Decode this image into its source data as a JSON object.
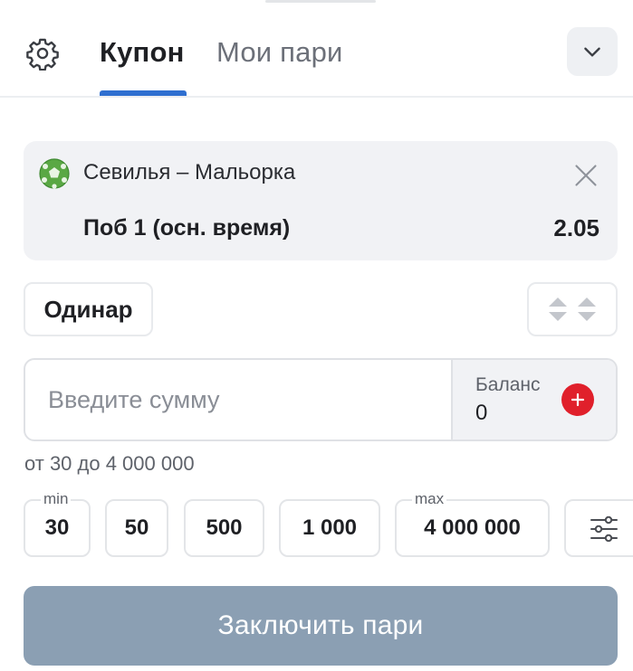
{
  "header": {
    "tabs": [
      {
        "label": "Купон",
        "active": true
      },
      {
        "label": "Мои пари",
        "active": false
      }
    ],
    "icons": {
      "settings": "gear-icon",
      "collapse": "chevron-down-icon"
    }
  },
  "bet": {
    "sport_icon": "soccer-ball-icon",
    "match": "Севилья – Мальорка",
    "outcome": "Поб 1 (осн. время)",
    "odds": "2.05"
  },
  "bet_type": {
    "label": "Одинар"
  },
  "amount": {
    "placeholder": "Введите сумму",
    "value": "",
    "balance_label": "Баланс",
    "balance_value": "0"
  },
  "limits_text": "от 30 до 4 000 000",
  "quick_amounts": [
    {
      "label": "30",
      "tag": "min"
    },
    {
      "label": "50",
      "tag": ""
    },
    {
      "label": "500",
      "tag": ""
    },
    {
      "label": "1 000",
      "tag": ""
    },
    {
      "label": "4 000 000",
      "tag": "max"
    }
  ],
  "submit_label": "Заключить пари",
  "colors": {
    "accent": "#2f6fd0",
    "submit_disabled": "#8b9fb3",
    "add_funds": "#e0202b",
    "card_bg": "#f1f2f5"
  }
}
